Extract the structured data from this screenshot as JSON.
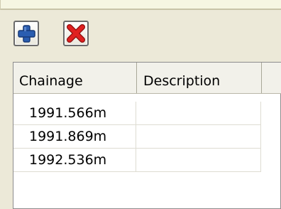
{
  "toolbar": {
    "add_icon": "plus-icon",
    "delete_icon": "red-x-icon",
    "add_color": "#2a5db0",
    "delete_color": "#e02020"
  },
  "table": {
    "columns": [
      "Chainage",
      "Description"
    ],
    "rows": [
      {
        "chainage": "1991.566m",
        "description": ""
      },
      {
        "chainage": "1991.869m",
        "description": ""
      },
      {
        "chainage": "1992.536m",
        "description": ""
      }
    ]
  }
}
